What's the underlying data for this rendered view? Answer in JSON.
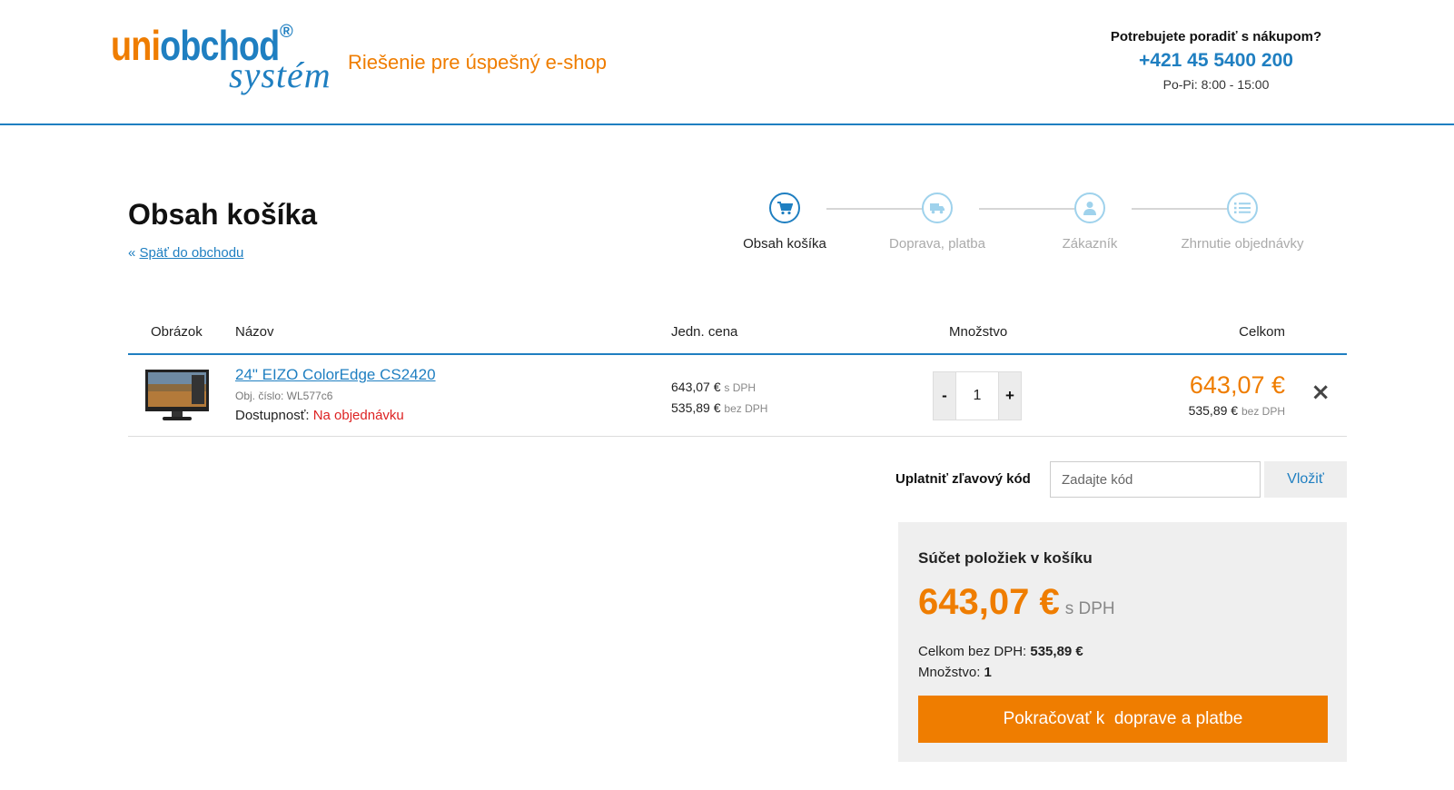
{
  "header": {
    "logo_main_a": "uni",
    "logo_main_b": "obchod",
    "logo_reg": "®",
    "logo_sub": "systém",
    "tagline": "Riešenie pre úspešný e-shop",
    "help_question": "Potrebujete poradiť s nákupom?",
    "phone": "+421 45 5400 200",
    "hours": "Po-Pi: 8:00 - 15:00"
  },
  "page": {
    "title": "Obsah košíka",
    "back_link": "Späť do obchodu",
    "back_icon": "«"
  },
  "steps": [
    {
      "label": "Obsah košíka",
      "icon": "cart-icon",
      "active": true
    },
    {
      "label": "Doprava, platba",
      "icon": "truck-icon",
      "active": false
    },
    {
      "label": "Zákazník",
      "icon": "user-icon",
      "active": false
    },
    {
      "label": "Zhrnutie objednávky",
      "icon": "list-icon",
      "active": false
    }
  ],
  "table": {
    "headers": {
      "image": "Obrázok",
      "name": "Názov",
      "unit_price": "Jedn. cena",
      "quantity": "Množstvo",
      "total": "Celkom"
    },
    "items": [
      {
        "name": "24\" EIZO ColorEdge CS2420",
        "code": "Obj. číslo: WL577c6",
        "availability_label": "Dostupnosť:",
        "availability_value": "Na objednávku",
        "price_with_vat": "643,07 €",
        "with_vat_label": "s DPH",
        "price_without_vat": "535,89 €",
        "without_vat_label": "bez DPH",
        "quantity": "1",
        "qty_minus": "-",
        "qty_plus": "+",
        "total_with_vat": "643,07 €",
        "total_without_vat": "535,89 €",
        "remove_icon": "×"
      }
    ]
  },
  "coupon": {
    "label": "Uplatniť zľavový kód",
    "placeholder": "Zadajte kód",
    "button": "Vložiť"
  },
  "summary": {
    "title": "Súčet položiek v košíku",
    "total": "643,07 €",
    "total_vat_label": "s DPH",
    "without_vat_label": "Celkom bez DPH:",
    "without_vat_value": "535,89 €",
    "quantity_label": "Množstvo:",
    "quantity_value": "1",
    "cta": "Pokračovať k  doprave a platbe"
  },
  "colors": {
    "brand_blue": "#1f7fc1",
    "brand_orange": "#ef7d00",
    "danger": "#dd2222"
  }
}
